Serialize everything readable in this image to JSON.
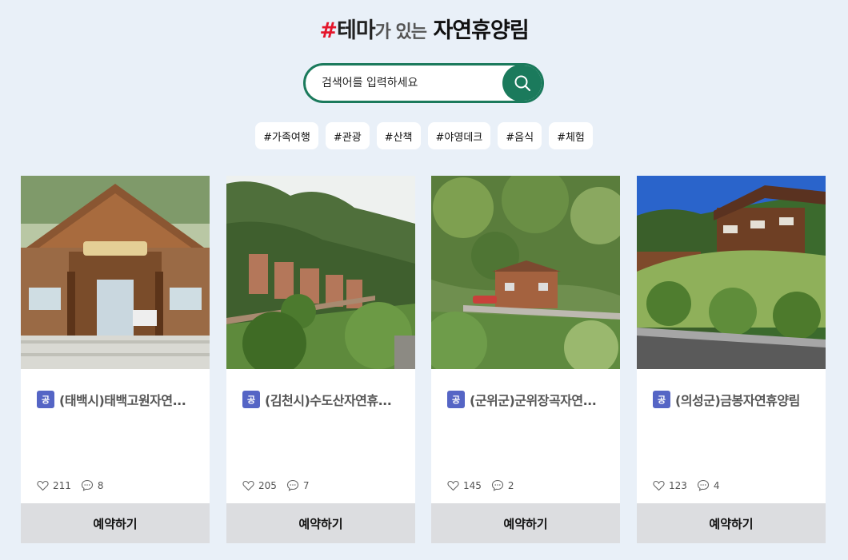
{
  "header": {
    "hash": "#",
    "theme": "테마",
    "mid": "가 있는",
    "main": "자연휴양림"
  },
  "search": {
    "placeholder": "검색어를 입력하세요",
    "icon": "search-icon"
  },
  "tags": [
    "#가족여행",
    "#관광",
    "#산책",
    "#야영데크",
    "#음식",
    "#체험"
  ],
  "cards": [
    {
      "badge": "공",
      "name": "(태백시)태백고원자연...",
      "likes": "211",
      "comments": "8",
      "button": "예약하기"
    },
    {
      "badge": "공",
      "name": "(김천시)수도산자연휴...",
      "likes": "205",
      "comments": "7",
      "button": "예약하기"
    },
    {
      "badge": "공",
      "name": "(군위군)군위장곡자연...",
      "likes": "145",
      "comments": "2",
      "button": "예약하기"
    },
    {
      "badge": "공",
      "name": "(의성군)금봉자연휴양림",
      "likes": "123",
      "comments": "4",
      "button": "예약하기"
    }
  ],
  "colors": {
    "background": "#e9f0f8",
    "accent_green": "#1b7a5c",
    "hash_red": "#e4162b",
    "badge_blue": "#5565c5",
    "button_gray": "#dcdde0"
  },
  "icons": {
    "like": "heart-icon",
    "comment": "comment-icon"
  }
}
